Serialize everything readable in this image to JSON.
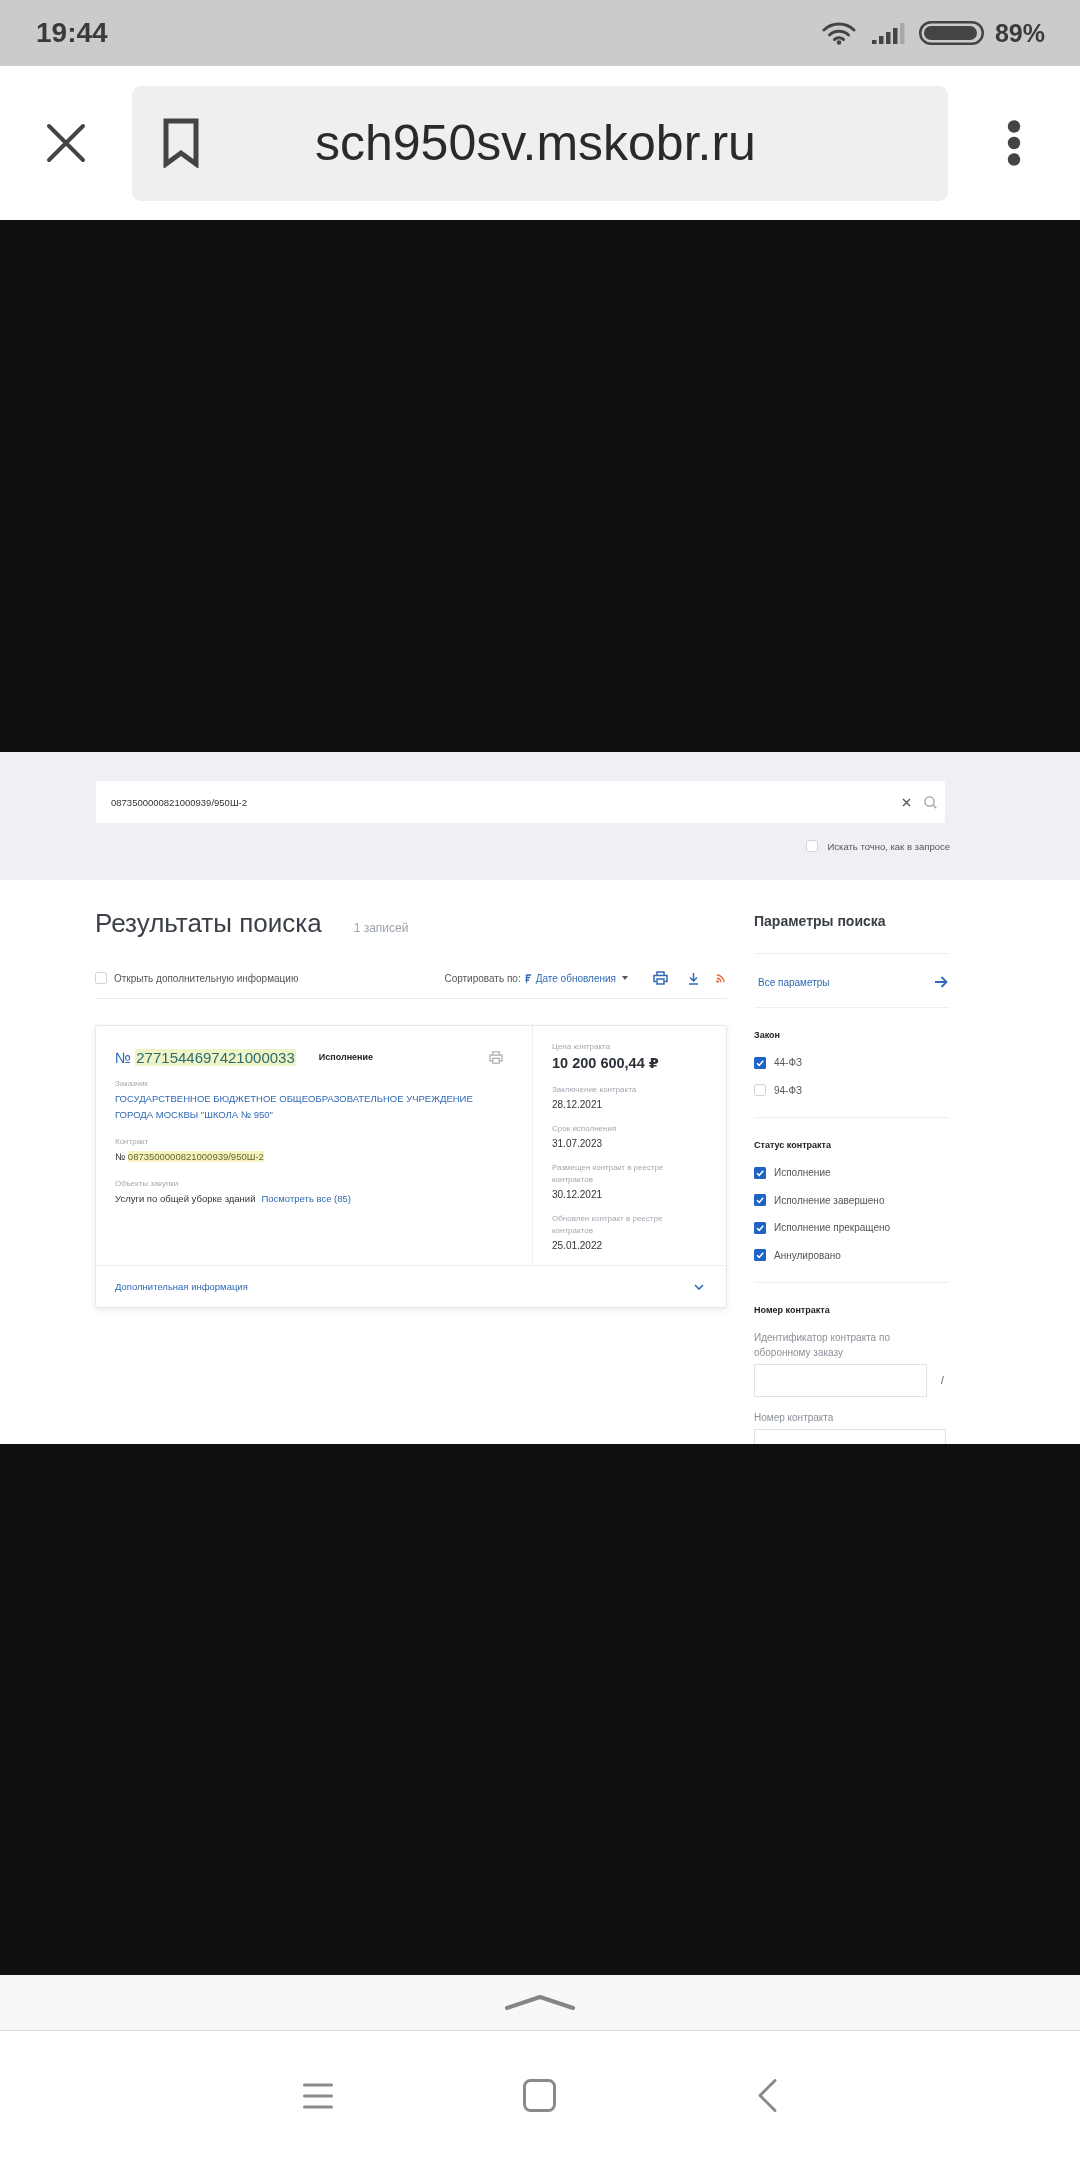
{
  "status_bar": {
    "time": "19:44",
    "battery_percent": "89%"
  },
  "browser_bar": {
    "url": "sch950sv.mskobr.ru"
  },
  "search": {
    "value": "0873500000821000939/950Ш-2",
    "exact_match": {
      "label": "Искать точно, как в запросе",
      "checked": false
    }
  },
  "results": {
    "title": "Результаты поиска",
    "count": "1 записей",
    "open_info": {
      "label": "Открыть дополнительную информацию",
      "checked": false
    },
    "sort": {
      "label": "Сортировать по:",
      "value": "Дате обновления"
    },
    "cards": [
      {
        "number_sign": "№",
        "number": "2771544697421000033",
        "number_highlighted": true,
        "status": "Исполнение",
        "customer": {
          "label": "Заказчик",
          "value": "ГОСУДАРСТВЕННОЕ БЮДЖЕТНОЕ ОБЩЕОБРАЗОВАТЕЛЬНОЕ УЧРЕЖДЕНИЕ ГОРОДА МОСКВЫ \"ШКОЛА № 950\""
        },
        "contract": {
          "label": "Контракт",
          "number_sign": "№",
          "number": "0873500000821000939/950Ш-2",
          "highlighted": true
        },
        "objects": {
          "label": "Объекты закупки",
          "value": "Услуги по общей уборке зданий",
          "link": "Посмотреть все (85)"
        },
        "details": [
          {
            "kind": "price",
            "label": "Цена контракта",
            "value": "10 200 600,44 ₽"
          },
          {
            "kind": "date",
            "label": "Заключение контракта",
            "value": "28.12.2021"
          },
          {
            "kind": "date",
            "label": "Срок исполнения",
            "value": "31.07.2023"
          },
          {
            "kind": "date",
            "label": "Размещен контракт в реестре контрактов",
            "value": "30.12.2021"
          },
          {
            "kind": "date",
            "label": "Обновлен контракт в реестре контрактов",
            "value": "25.01.2022"
          }
        ],
        "more_info": {
          "label": "Дополнительная информация",
          "expanded": false
        }
      }
    ]
  },
  "filters": {
    "title": "Параметры поиска",
    "all_params": "Все параметры",
    "groups": [
      {
        "title": "Закон",
        "options": [
          {
            "label": "44-ФЗ",
            "checked": true
          },
          {
            "label": "94-ФЗ",
            "checked": false
          }
        ]
      },
      {
        "title": "Статус контракта",
        "options": [
          {
            "label": "Исполнение",
            "checked": true
          },
          {
            "label": "Исполнение завершено",
            "checked": true
          },
          {
            "label": "Исполнение прекращено",
            "checked": true
          },
          {
            "label": "Аннулировано",
            "checked": true
          }
        ]
      }
    ],
    "contract_number": {
      "title": "Номер контракта",
      "fields": [
        {
          "label": "Идентификатор контракта по оборонному заказу",
          "separator": "/"
        },
        {
          "label": "Номер контракта"
        }
      ]
    }
  }
}
